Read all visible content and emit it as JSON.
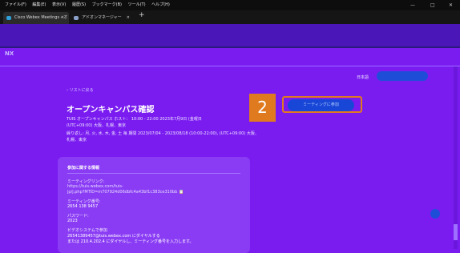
{
  "menubar": {
    "items": [
      "ファイル(F)",
      "編集(E)",
      "表示(V)",
      "履歴(S)",
      "ブックマーク(B)",
      "ツール(T)",
      "ヘルプ(H)"
    ],
    "minimize": "—",
    "maximize": "□",
    "close": "✕"
  },
  "tabs": [
    {
      "label": "Cisco Webex Meetings - オープン",
      "close": "×"
    },
    {
      "label": "アドオンマネージャー",
      "close": "×"
    }
  ],
  "new_tab": "+",
  "logo": "NX",
  "header": {
    "language": "日本語",
    "signin_label": ""
  },
  "back_link": "‹ リストに戻る",
  "title": "オープンキャンパス確認",
  "meta": {
    "line1": "TUIS オープンキャンパス  ホスト：  10:00 - 22:00  2023年7月9日 (金曜日",
    "line2": "(UTC+09:00) 大阪、札幌、東京",
    "line3": "繰り返し: 月, 火, 水, 木, 金, 土 毎 期間 2023/07/04 - 2023/08/18 (10:00-22:00), (UTC+09:00) 大阪、札幌、東京"
  },
  "badge": "2",
  "join_button_label": "ミーティングに参加",
  "info_card": {
    "title": "参加に関する情報",
    "meeting_link_label": "ミーティングリンク:",
    "meeting_link": "https://tuis.webex.com/tuis-",
    "meeting_link2": "jp/j.php?MTID=m707924d06dbfc4a43bf1c383ce310bb 📋",
    "meeting_number_label": "ミーティング番号:",
    "meeting_number": "2654 138 9457",
    "password_label": "パスワード:",
    "password": "2023",
    "video_label": "ビデオシステムで参加",
    "video_line1": "26541389457@tuis.webex.com にダイヤルする",
    "video_line2": "または 210.4.202.4 にダイヤルし、ミーティング番号を入力します。"
  },
  "colors": {
    "background": "#7a1cf0",
    "badge": "#e07a1f",
    "accent": "#1846d6"
  }
}
